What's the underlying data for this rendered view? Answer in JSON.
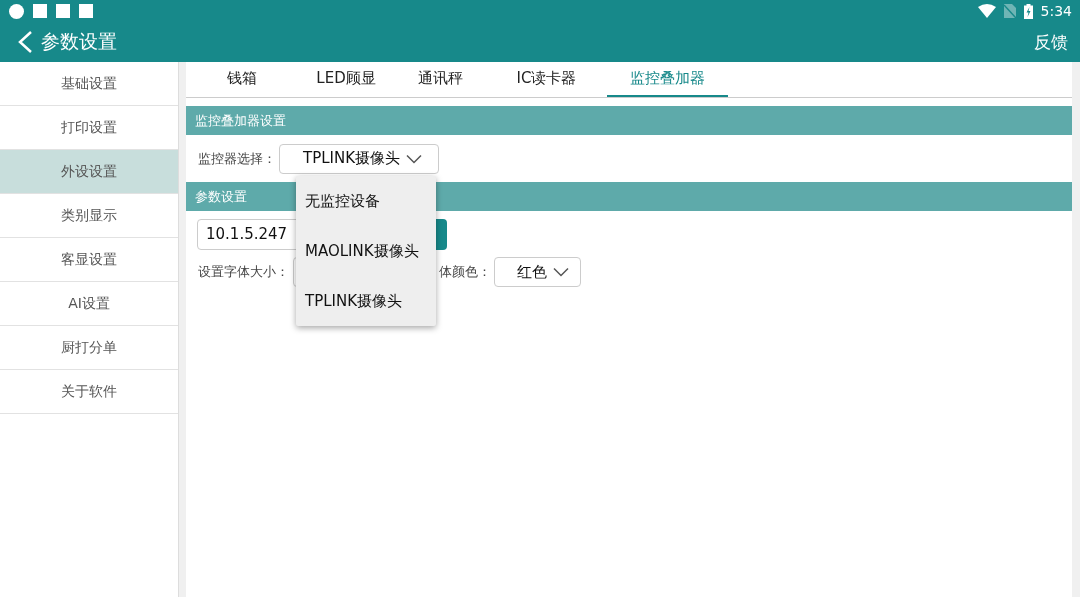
{
  "status_bar": {
    "time": "5:34"
  },
  "app_bar": {
    "title": "参数设置",
    "action": "反馈"
  },
  "sidebar": {
    "items": [
      {
        "label": "基础设置",
        "selected": false
      },
      {
        "label": "打印设置",
        "selected": false
      },
      {
        "label": "外设设置",
        "selected": true
      },
      {
        "label": "类别显示",
        "selected": false
      },
      {
        "label": "客显设置",
        "selected": false
      },
      {
        "label": "AI设置",
        "selected": false
      },
      {
        "label": "厨打分单",
        "selected": false
      },
      {
        "label": "关于软件",
        "selected": false
      }
    ]
  },
  "tabs": [
    {
      "label": "钱箱",
      "selected": false
    },
    {
      "label": "LED顾显",
      "selected": false
    },
    {
      "label": "通讯秤",
      "selected": false
    },
    {
      "label": "IC读卡器",
      "selected": false
    },
    {
      "label": "监控叠加器",
      "selected": true
    }
  ],
  "monitor_section": {
    "title": "监控叠加器设置",
    "field_label": "监控器选择：",
    "value": "TPLINK摄像头"
  },
  "params_section": {
    "title": "参数设置",
    "ip_value": "10.1.5.247",
    "font_size_label": "设置字体大小：",
    "font_color_label": "体颜色：",
    "font_color_value": "红色"
  },
  "dropdown_menu": {
    "options": [
      {
        "label": "无监控设备"
      },
      {
        "label": "MAOLINK摄像头"
      },
      {
        "label": "TPLINK摄像头"
      }
    ]
  }
}
